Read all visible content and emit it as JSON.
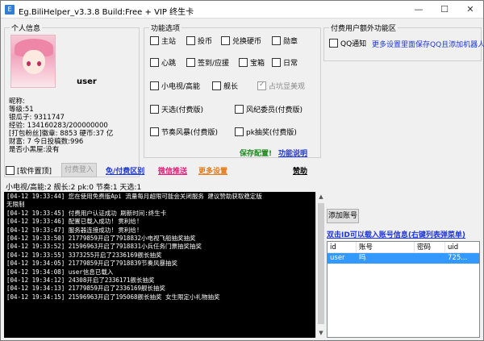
{
  "window": {
    "title": "Eg.BiliHelper_v3.3.8   Build:Free   + VIP 终生卡",
    "minimize": "—",
    "maximize": "☐",
    "close": "✕"
  },
  "personal": {
    "group_title": "个人信息",
    "username": "user",
    "nickname": "昵称:",
    "level": "等级:51",
    "silver": "银瓜子: 9311747",
    "exp": "经验: 134160283/200000000",
    "medal": "[打包粉丝]徽章: 8853  硬币:37 亿",
    "wealth": "财富: 7  今日投稿数:996",
    "vip": "是否小黑屋:没有"
  },
  "features": {
    "group_title": "功能选项",
    "items": [
      {
        "label": "主站",
        "checked": false
      },
      {
        "label": "投币",
        "checked": false
      },
      {
        "label": "兑换硬币",
        "checked": false
      },
      {
        "label": "勋章",
        "checked": false
      },
      {
        "label": "心跳",
        "checked": false
      },
      {
        "label": "签到/应援",
        "checked": false
      },
      {
        "label": "宝箱",
        "checked": false
      },
      {
        "label": "日常",
        "checked": false
      },
      {
        "label": "小电视/高能",
        "checked": false
      },
      {
        "label": "舰长",
        "checked": false
      },
      {
        "label": "占坑显美观",
        "checked": true,
        "disabled": true
      },
      {
        "label": "天选(付费版)",
        "checked": false
      },
      {
        "label": "风纪委员(付费版)",
        "checked": false
      },
      {
        "label": "节奏风暴(付费版)",
        "checked": false
      },
      {
        "label": "pk抽奖(付费版)",
        "checked": false
      }
    ],
    "save_config": "保存配置!",
    "func_desc": "功能说明"
  },
  "paid": {
    "group_title": "付费用户额外功能区",
    "qq_notify": "QQ通知",
    "more_settings": "更多设置里面保存QQ且添加机器人"
  },
  "actions": {
    "software_top": "[软件置顶]",
    "paid_login": "付费登入",
    "free_diff": "免/付费区别",
    "wechat_push": "微信推送",
    "more_settings": "更多设置",
    "sponsor": "赞助"
  },
  "status_line": "小电视/高能:2  舰长:2  pk:0  节奏:1  天选:1",
  "log": [
    "[04-12 19:33:44] 您在使用免费版Api 流量每月超限可能会关闭服务 建议赞助获取稳定版",
    "无限制",
    "[04-12 19:33:45] 付费用户认证成功  刷新时间:终生卡",
    "[04-12 19:33:46] 配置已载入成功! 贯利给!",
    "[04-12 19:33:47] 服务器连接成功! 贯利给!",
    "[04-12 19:33:50] 21779859开启了7918832小电视飞船抽奖抽奖",
    "[04-12 19:33:52] 21596963开启了7918831小兵任务门票抽奖抽奖",
    "[04-12 19:33:55] 3373255开启了2336169舰长抽奖",
    "[04-12 19:34:05] 21779859开启了7918839节奏风暴抽奖",
    "[04-12 19:34:08] user信息已载入",
    "[04-12 19:34:12] 24308开启了2336171舰长抽奖",
    "[04-12 19:34:13] 21779859开启了2336169舰长抽奖",
    "[04-12 19:34:15] 21596963开启了195068舰长抽奖  女生限定小礼物抽奖"
  ],
  "accounts": {
    "add_button": "添加账号",
    "hint": "双击ID可以载入账号信息(右键列表弹菜单)",
    "columns": [
      "id",
      "账号",
      "密码",
      "uid"
    ],
    "rows": [
      {
        "id": "user",
        "account": "吗",
        "password": "",
        "uid": "725..."
      }
    ]
  }
}
